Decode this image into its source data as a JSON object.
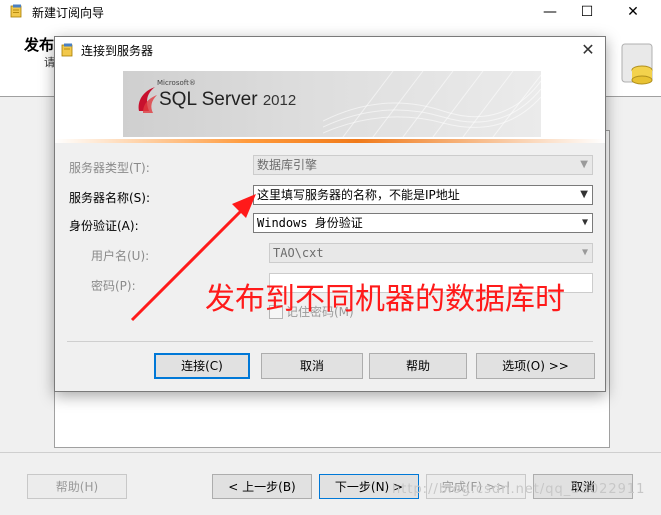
{
  "wizard": {
    "title": "新建订阅向导",
    "heading": "发布",
    "heading_sub": "请",
    "window_controls": {
      "minimize": "—",
      "maximize": "☐",
      "close": "✕"
    },
    "footer": {
      "help": "帮助(H)",
      "back": "< 上一步(B)",
      "next": "下一步(N) >",
      "finish": "完成(F) >>|",
      "cancel": "取消"
    },
    "watermark": "http://blog.csdn.net/qq_33022911"
  },
  "dialog": {
    "title": "连接到服务器",
    "close": "✕",
    "brand_small": "Microsoft®",
    "brand": "SQL Server",
    "brand_year": "2012",
    "fields": {
      "server_type_label": "服务器类型(T):",
      "server_type_value": "数据库引擎",
      "server_name_label": "服务器名称(S):",
      "server_name_value": "这里填写服务器的名称，不能是IP地址",
      "auth_label": "身份验证(A):",
      "auth_value": "Windows 身份验证",
      "username_label": "用户名(U):",
      "username_value": "TAO\\cxt",
      "password_label": "密码(P):",
      "remember_label": "记住密码(M)"
    },
    "buttons": {
      "connect": "连接(C)",
      "cancel": "取消",
      "help": "帮助",
      "options": "选项(O) >>"
    }
  },
  "annotation": {
    "text": "发布到不同机器的数据库时",
    "color": "#ff1a1a"
  },
  "icons": [
    "wizard-app-icon",
    "dialog-app-icon",
    "chevron-down-icon",
    "close-icon",
    "minimize-icon",
    "maximize-icon",
    "sql-server-logo-icon",
    "red-arrow"
  ]
}
